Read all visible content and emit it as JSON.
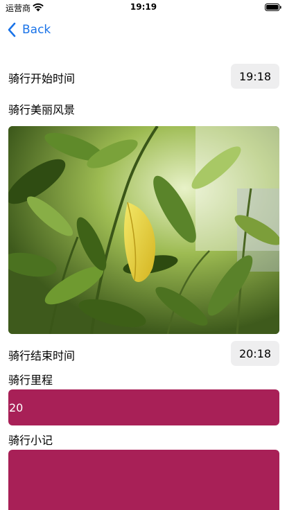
{
  "status_bar": {
    "carrier": "运营商",
    "time": "19:19",
    "wifi_icon": "wifi-icon",
    "battery_icon": "battery-icon"
  },
  "nav": {
    "back_label": "Back",
    "back_icon": "chevron-left-icon",
    "accent_color": "#1a73e8"
  },
  "form": {
    "start_time_label": "骑行开始时间",
    "start_time_value": "19:18",
    "scenery_label": "骑行美丽风景",
    "scenery_photo": "leaf-photo",
    "end_time_label": "骑行结束时间",
    "end_time_value": "20:18",
    "distance_label": "骑行里程",
    "distance_value": "20",
    "note_label": "骑行小记",
    "note_value": "",
    "field_color": "#a82057"
  }
}
